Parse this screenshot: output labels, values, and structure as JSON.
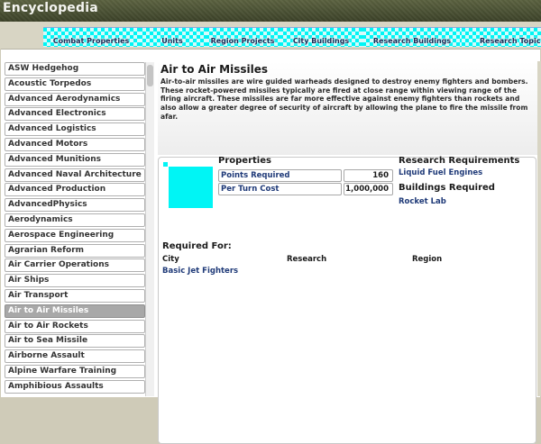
{
  "window": {
    "title": "Encyclopedia"
  },
  "tabs": [
    {
      "label": "Combat Properties"
    },
    {
      "label": "Units"
    },
    {
      "label": "Region Projects"
    },
    {
      "label": "City Buildings"
    },
    {
      "label": "Research Buildings"
    },
    {
      "label": "Research Topics"
    }
  ],
  "list": {
    "items": [
      "ASW Hedgehog",
      "Acoustic Torpedos",
      "Advanced Aerodynamics",
      "Advanced Electronics",
      "Advanced Logistics",
      "Advanced Motors",
      "Advanced Munitions",
      "Advanced Naval Architecture",
      "Advanced Production",
      "AdvancedPhysics",
      "Aerodynamics",
      "Aerospace Engineering",
      "Agrarian Reform",
      "Air Carrier Operations",
      "Air Ships",
      "Air Transport",
      "Air to Air Missiles",
      "Air to Air Rockets",
      "Air to Sea Missile",
      "Airborne Assault",
      "Alpine Warfare Training",
      "Amphibious Assaults"
    ],
    "selected": "Air to Air Missiles"
  },
  "detail": {
    "title": "Air to Air Missiles",
    "description": "Air-to-air missiles are wire guided warheads designed to destroy enemy fighters and bombers. These rocket-powered missiles typically are fired at close range within viewing range of the firing aircraft. These missiles are far more effective against enemy fighters than rockets and also allow a greater degree of security of aircraft by allowing the plane to fire the missile from afar.",
    "properties": {
      "title": "Properties",
      "rows": [
        {
          "label": "Points Required",
          "value": "160"
        },
        {
          "label": "Per Turn Cost",
          "value": "1,000,000"
        }
      ]
    },
    "research_requirements": {
      "title": "Research Requirements",
      "items": [
        "Liquid Fuel Engines"
      ]
    },
    "buildings_required": {
      "title": "Buildings Required",
      "items": [
        "Rocket Lab"
      ]
    },
    "required_for": {
      "title": "Required For:",
      "columns": [
        "City",
        "Research",
        "Region"
      ],
      "city": [
        "Basic Jet Fighters"
      ]
    }
  },
  "colors": {
    "accent_cyan": "#00f5f5",
    "link_blue": "#1f3a78",
    "selected_gray": "#a8a8a8"
  }
}
